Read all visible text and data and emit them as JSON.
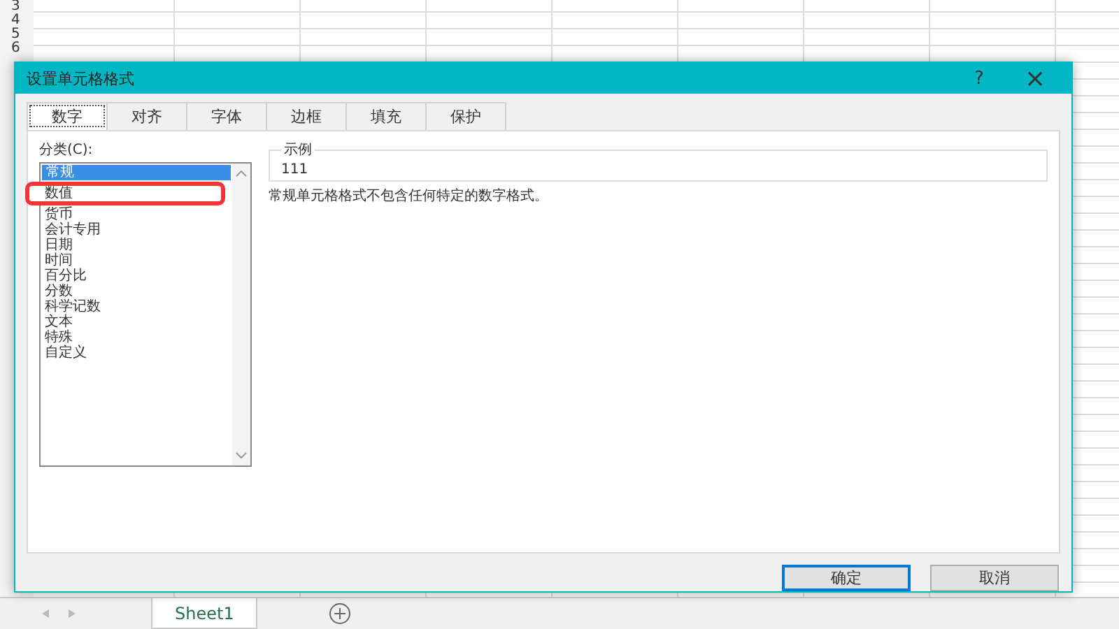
{
  "sheet": {
    "row_headers": [
      "3",
      "4",
      "5",
      "6"
    ],
    "tabs": [
      {
        "label": "Sheet1",
        "selected": true
      }
    ]
  },
  "dialog": {
    "title": "设置单元格格式",
    "help": "?",
    "close": "×",
    "tabs": [
      {
        "label": "数字",
        "selected": true
      },
      {
        "label": "对齐",
        "selected": false
      },
      {
        "label": "字体",
        "selected": false
      },
      {
        "label": "边框",
        "selected": false
      },
      {
        "label": "填充",
        "selected": false
      },
      {
        "label": "保护",
        "selected": false
      }
    ],
    "category_label": "分类(C):",
    "categories": [
      {
        "label": "常规",
        "selected": true,
        "highlighted": false
      },
      {
        "label": "数值",
        "selected": false,
        "highlighted": true
      },
      {
        "label": "货币",
        "selected": false,
        "highlighted": false
      },
      {
        "label": "会计专用",
        "selected": false,
        "highlighted": false
      },
      {
        "label": "日期",
        "selected": false,
        "highlighted": false
      },
      {
        "label": "时间",
        "selected": false,
        "highlighted": false
      },
      {
        "label": "百分比",
        "selected": false,
        "highlighted": false
      },
      {
        "label": "分数",
        "selected": false,
        "highlighted": false
      },
      {
        "label": "科学记数",
        "selected": false,
        "highlighted": false
      },
      {
        "label": "文本",
        "selected": false,
        "highlighted": false
      },
      {
        "label": "特殊",
        "selected": false,
        "highlighted": false
      },
      {
        "label": "自定义",
        "selected": false,
        "highlighted": false
      }
    ],
    "sample": {
      "legend": "示例",
      "value": "111"
    },
    "description": "常规单元格格式不包含任何特定的数字格式。",
    "buttons": [
      {
        "label": "确定",
        "default": true
      },
      {
        "label": "取消",
        "default": false
      }
    ]
  }
}
